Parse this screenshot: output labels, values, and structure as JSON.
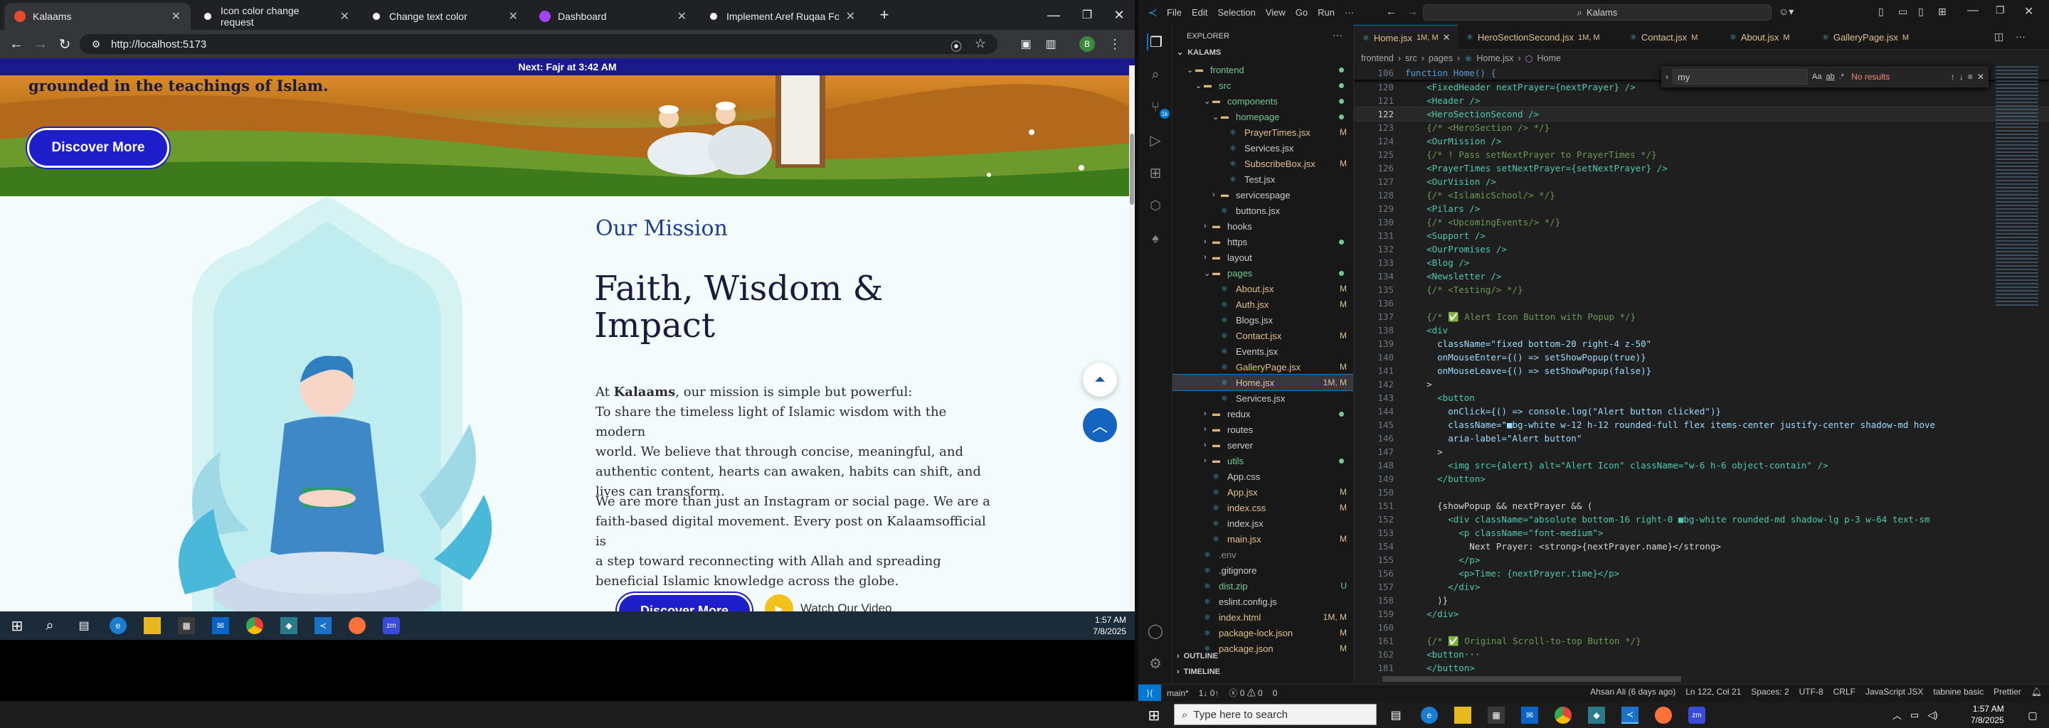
{
  "chrome": {
    "tabs": [
      {
        "title": "Kalaams",
        "active": true
      },
      {
        "title": "Icon color change request",
        "active": false
      },
      {
        "title": "Change text color",
        "active": false
      },
      {
        "title": "Dashboard",
        "active": false
      },
      {
        "title": "Implement Aref Ruqaa Font in R",
        "active": false
      }
    ],
    "new_tab": "+",
    "url": "http://localhost:5173"
  },
  "site": {
    "banner": "Next: Fajr at 3:42 AM",
    "hero_text": "grounded in the teachings of Islam.",
    "discover_button": "Discover More",
    "mission_eyebrow": "Our Mission",
    "mission_heading": "Faith, Wisdom & Impact",
    "para1_prefix": "At ",
    "para1_brand": "Kalaams",
    "para1_suffix": ", our mission is simple but powerful:",
    "para1_lines": [
      "To share the timeless light of Islamic wisdom with the modern",
      "world. We believe that through concise, meaningful, and",
      "authentic content, hearts can awaken, habits can shift, and",
      "lives can transform."
    ],
    "para2_lines": [
      "We are more than just an Instagram or social page. We are a",
      "faith-based digital movement. Every post on Kalaamsofficial is",
      "a step toward reconnecting with Allah and spreading",
      "beneficial Islamic knowledge across the globe."
    ],
    "bottom_button": "Discover More",
    "watch_label": "Watch Our Video"
  },
  "win_taskbar": {
    "time": "1:57 AM",
    "date": "7/8/2025"
  },
  "vscode": {
    "menu": [
      "File",
      "Edit",
      "Selection",
      "View",
      "Go",
      "Run",
      "···"
    ],
    "search": "Kalams",
    "explorer_title": "EXPLORER",
    "project": "KALAMS",
    "tree": [
      {
        "label": "frontend",
        "indent": 1,
        "kind": "folder-open",
        "color": "#73c991",
        "status": "dot"
      },
      {
        "label": "src",
        "indent": 2,
        "kind": "folder-open",
        "color": "#73c991",
        "status": "dot"
      },
      {
        "label": "components",
        "indent": 3,
        "kind": "folder-open",
        "color": "#73c991",
        "status": "dot"
      },
      {
        "label": "homepage",
        "indent": 4,
        "kind": "folder-open",
        "color": "#73c991",
        "status": "dot"
      },
      {
        "label": "PrayerTimes.jsx",
        "indent": 5,
        "kind": "file",
        "color": "#e2c08d",
        "status": "M"
      },
      {
        "label": "Services.jsx",
        "indent": 5,
        "kind": "file",
        "color": "#cccccc",
        "status": ""
      },
      {
        "label": "SubscribeBox.jsx",
        "indent": 5,
        "kind": "file",
        "color": "#e2c08d",
        "status": "M"
      },
      {
        "label": "Test.jsx",
        "indent": 5,
        "kind": "file",
        "color": "#cccccc",
        "status": ""
      },
      {
        "label": "servicespage",
        "indent": 4,
        "kind": "folder",
        "color": "#cccccc",
        "status": ""
      },
      {
        "label": "buttons.jsx",
        "indent": 4,
        "kind": "file",
        "color": "#cccccc",
        "status": ""
      },
      {
        "label": "hooks",
        "indent": 3,
        "kind": "folder",
        "color": "#cccccc",
        "status": ""
      },
      {
        "label": "https",
        "indent": 3,
        "kind": "folder",
        "color": "#cccccc",
        "status": "dot"
      },
      {
        "label": "layout",
        "indent": 3,
        "kind": "folder",
        "color": "#cccccc",
        "status": ""
      },
      {
        "label": "pages",
        "indent": 3,
        "kind": "folder-open",
        "color": "#73c991",
        "status": "dot"
      },
      {
        "label": "About.jsx",
        "indent": 4,
        "kind": "file",
        "color": "#e2c08d",
        "status": "M"
      },
      {
        "label": "Auth.jsx",
        "indent": 4,
        "kind": "file",
        "color": "#e2c08d",
        "status": "M"
      },
      {
        "label": "Blogs.jsx",
        "indent": 4,
        "kind": "file",
        "color": "#cccccc",
        "status": ""
      },
      {
        "label": "Contact.jsx",
        "indent": 4,
        "kind": "file",
        "color": "#e2c08d",
        "status": "M"
      },
      {
        "label": "Events.jsx",
        "indent": 4,
        "kind": "file",
        "color": "#cccccc",
        "status": ""
      },
      {
        "label": "GalleryPage.jsx",
        "indent": 4,
        "kind": "file",
        "color": "#e2c08d",
        "status": "M"
      },
      {
        "label": "Home.jsx",
        "indent": 4,
        "kind": "file",
        "color": "#e2c08d",
        "status": "1M, M",
        "selected": true
      },
      {
        "label": "Services.jsx",
        "indent": 4,
        "kind": "file",
        "color": "#cccccc",
        "status": ""
      },
      {
        "label": "redux",
        "indent": 3,
        "kind": "folder",
        "color": "#cccccc",
        "status": "dot"
      },
      {
        "label": "routes",
        "indent": 3,
        "kind": "folder",
        "color": "#cccccc",
        "status": ""
      },
      {
        "label": "server",
        "indent": 3,
        "kind": "folder",
        "color": "#cccccc",
        "status": ""
      },
      {
        "label": "utils",
        "indent": 3,
        "kind": "folder",
        "color": "#73c991",
        "status": "dot"
      },
      {
        "label": "App.css",
        "indent": 3,
        "kind": "file",
        "color": "#cccccc",
        "status": ""
      },
      {
        "label": "App.jsx",
        "indent": 3,
        "kind": "file",
        "color": "#e2c08d",
        "status": "M"
      },
      {
        "label": "index.css",
        "indent": 3,
        "kind": "file",
        "color": "#e2c08d",
        "status": "M"
      },
      {
        "label": "index.jsx",
        "indent": 3,
        "kind": "file",
        "color": "#cccccc",
        "status": ""
      },
      {
        "label": "main.jsx",
        "indent": 3,
        "kind": "file",
        "color": "#e2c08d",
        "status": "M"
      },
      {
        "label": ".env",
        "indent": 2,
        "kind": "file",
        "color": "#8b8b8b",
        "status": ""
      },
      {
        "label": ".gitignore",
        "indent": 2,
        "kind": "file",
        "color": "#cccccc",
        "status": ""
      },
      {
        "label": "dist.zip",
        "indent": 2,
        "kind": "file",
        "color": "#73c991",
        "status": "U"
      },
      {
        "label": "eslint.config.js",
        "indent": 2,
        "kind": "file",
        "color": "#cccccc",
        "status": ""
      },
      {
        "label": "index.html",
        "indent": 2,
        "kind": "file",
        "color": "#e2c08d",
        "status": "1M, M"
      },
      {
        "label": "package-lock.json",
        "indent": 2,
        "kind": "file",
        "color": "#e2c08d",
        "status": "M"
      },
      {
        "label": "package.json",
        "indent": 2,
        "kind": "file",
        "color": "#e2c08d",
        "status": "M"
      }
    ],
    "outline": "OUTLINE",
    "timeline": "TIMELINE",
    "editor_tabs": [
      {
        "label": "Home.jsx",
        "meta": "1M, M",
        "active": true
      },
      {
        "label": "HeroSectionSecond.jsx",
        "meta": "1M, M",
        "active": false
      },
      {
        "label": "Contact.jsx",
        "meta": "M",
        "active": false
      },
      {
        "label": "About.jsx",
        "meta": "M",
        "active": false
      },
      {
        "label": "GalleryPage.jsx",
        "meta": "M",
        "active": false
      }
    ],
    "breadcrumb": [
      "frontend",
      "src",
      "pages",
      "Home.jsx",
      "Home"
    ],
    "sticky_line": {
      "num": "106",
      "text": "function Home() {"
    },
    "find": {
      "query": "my",
      "result": "No results"
    },
    "code": [
      {
        "num": "120",
        "text": "    <FixedHeader nextPrayer={nextPrayer} />"
      },
      {
        "num": "121",
        "text": "    <Header />"
      },
      {
        "num": "122",
        "text": "    <HeroSectionSecond />"
      },
      {
        "num": "123",
        "text": "    {/* <HeroSection /> */}"
      },
      {
        "num": "124",
        "text": "    <OurMission />"
      },
      {
        "num": "125",
        "text": "    {/* ! Pass setNextPrayer to PrayerTimes */}"
      },
      {
        "num": "126",
        "text": "    <PrayerTimes setNextPrayer={setNextPrayer} />"
      },
      {
        "num": "127",
        "text": "    <OurVision />"
      },
      {
        "num": "128",
        "text": "    {/* <IslamicSchool/> */}"
      },
      {
        "num": "129",
        "text": "    <Pilars />"
      },
      {
        "num": "130",
        "text": "    {/* <UpcomingEvents/> */}"
      },
      {
        "num": "131",
        "text": "    <Support />"
      },
      {
        "num": "132",
        "text": "    <OurPromises />"
      },
      {
        "num": "133",
        "text": "    <Blog />"
      },
      {
        "num": "134",
        "text": "    <Newsletter />"
      },
      {
        "num": "135",
        "text": "    {/* <Testing/> */}"
      },
      {
        "num": "136",
        "text": ""
      },
      {
        "num": "137",
        "text": "    {/* ✅ Alert Icon Button with Popup */}"
      },
      {
        "num": "138",
        "text": "    <div"
      },
      {
        "num": "139",
        "text": "      className=\"fixed bottom-20 right-4 z-50\""
      },
      {
        "num": "140",
        "text": "      onMouseEnter={() => setShowPopup(true)}"
      },
      {
        "num": "141",
        "text": "      onMouseLeave={() => setShowPopup(false)}"
      },
      {
        "num": "142",
        "text": "    >"
      },
      {
        "num": "143",
        "text": "      <button"
      },
      {
        "num": "144",
        "text": "        onClick={() => console.log(\"Alert button clicked\")}"
      },
      {
        "num": "145",
        "text": "        className=\"■bg-white w-12 h-12 rounded-full flex items-center justify-center shadow-md hove"
      },
      {
        "num": "146",
        "text": "        aria-label=\"Alert button\""
      },
      {
        "num": "147",
        "text": "      >"
      },
      {
        "num": "148",
        "text": "        <img src={alert} alt=\"Alert Icon\" className=\"w-6 h-6 object-contain\" />"
      },
      {
        "num": "149",
        "text": "      </button>"
      },
      {
        "num": "150",
        "text": ""
      },
      {
        "num": "151",
        "text": "      {showPopup && nextPrayer && ("
      },
      {
        "num": "152",
        "text": "        <div className=\"absolute bottom-16 right-0 ■bg-white rounded-md shadow-lg p-3 w-64 text-sm"
      },
      {
        "num": "153",
        "text": "          <p className=\"font-medium\">"
      },
      {
        "num": "154",
        "text": "            Next Prayer: <strong>{nextPrayer.name}</strong>"
      },
      {
        "num": "155",
        "text": "          </p>"
      },
      {
        "num": "156",
        "text": "          <p>Time: {nextPrayer.time}</p>"
      },
      {
        "num": "157",
        "text": "        </div>"
      },
      {
        "num": "158",
        "text": "      )}"
      },
      {
        "num": "159",
        "text": "    </div>"
      },
      {
        "num": "160",
        "text": ""
      },
      {
        "num": "161",
        "text": "    {/* ✅ Original Scroll-to-top Button */}"
      },
      {
        "num": "162",
        "text": "    <button···"
      },
      {
        "num": "181",
        "text": "    </button>"
      }
    ],
    "status": {
      "branch": "main*",
      "sync": "1↓ 0↑",
      "problems": "ⓧ 0 ⚠ 0",
      "ports": "0",
      "blame": "Ahsan Ali (6 days ago)",
      "position": "Ln 122, Col 21",
      "spaces": "Spaces: 2",
      "encoding": "UTF-8",
      "eol": "CRLF",
      "language": "JavaScript JSX",
      "tabnine": "tabnine basic",
      "prettier": "Prettier"
    }
  },
  "taskbar": {
    "search_placeholder": "Type here to search",
    "time": "1:57 AM",
    "date": "7/8/2025"
  },
  "colors": {
    "brand_blue": "#1a1a8c",
    "accent_blue": "#0078d4",
    "modified": "#e2c08d",
    "untracked": "#73c991"
  }
}
